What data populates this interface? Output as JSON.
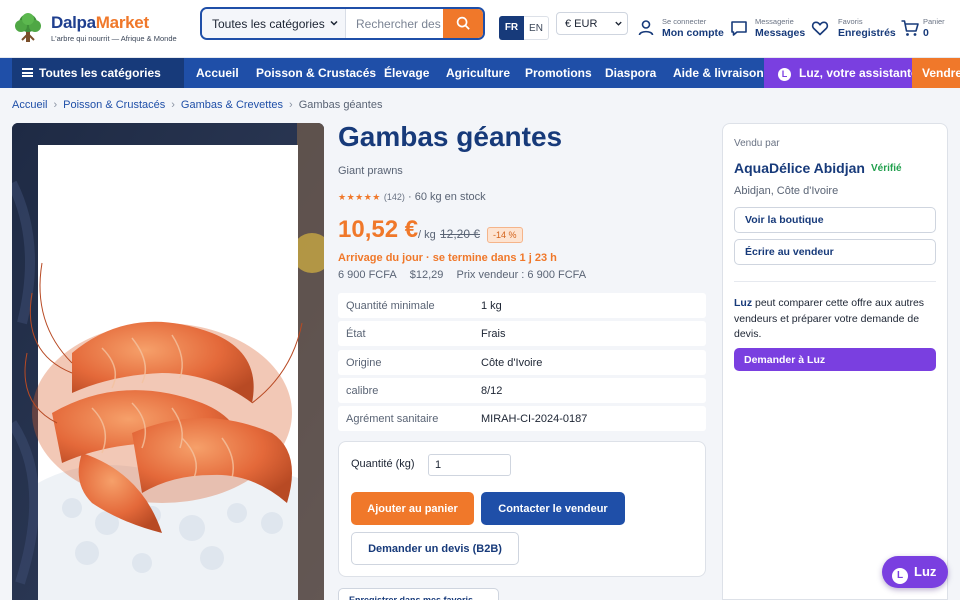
{
  "header": {
    "logo_part1": "Dalpa",
    "logo_part2": "Market",
    "tagline": "L'arbre qui nourrit — Afrique & Monde",
    "search": {
      "category": "Toutes les catégories",
      "placeholder": "Rechercher des produits"
    },
    "languages": {
      "active": "FR",
      "other": "EN"
    },
    "currency": "€ EUR",
    "account": {
      "small": "Se connecter",
      "big": "Mon compte"
    },
    "messages": {
      "small": "Messagerie",
      "big": "Messages"
    },
    "favorites": {
      "small": "Favoris",
      "big": "Enregistrés"
    },
    "cart": {
      "small": "Panier",
      "big": "0"
    }
  },
  "nav": {
    "all_categories": "Toutes les catégories",
    "links": [
      "Accueil",
      "Poisson & Crustacés",
      "Élevage",
      "Agriculture",
      "Promotions",
      "Diaspora",
      "Aide & livraison"
    ],
    "luz_badge": "L",
    "luz_label": "Luz, votre assistante",
    "sell_label": "Vendre"
  },
  "breadcrumb": [
    "Accueil",
    "Poisson & Crustacés",
    "Gambas & Crevettes",
    "Gambas géantes"
  ],
  "product": {
    "title": "Gambas géantes",
    "subtitle": "Giant prawns",
    "stars": "★★★★★",
    "reviews": "(142)",
    "stock": "· 60 kg en stock",
    "price": "10,52 €",
    "unit": "/ kg",
    "old_price": "12,20 €",
    "discount": "-14 %",
    "arrival": "Arrivage du jour · se termine dans 1 j 23 h",
    "price_fcfa": "6 900 FCFA",
    "price_usd": "$12,29",
    "seller_price": "Prix vendeur : 6 900 FCFA",
    "specs": [
      {
        "key": "Quantité minimale",
        "value": "1 kg"
      },
      {
        "key": "État",
        "value": "Frais"
      },
      {
        "key": "Origine",
        "value": "Côte d'Ivoire"
      },
      {
        "key": "calibre",
        "value": "8/12"
      },
      {
        "key": "Agrément sanitaire",
        "value": "MIRAH-CI-2024-0187"
      }
    ],
    "quantity_label": "Quantité (kg)",
    "quantity_value": "1",
    "add_to_cart": "Ajouter au panier",
    "contact_seller": "Contacter le vendeur",
    "request_quote": "Demander un devis (B2B)",
    "save_favorites": "Enregistrer dans mes favoris"
  },
  "seller": {
    "sold_by": "Vendu par",
    "name": "AquaDélice Abidjan",
    "verified": "Vérifié",
    "location": "Abidjan, Côte d'Ivoire",
    "view_shop": "Voir la boutique",
    "write_seller": "Écrire au vendeur",
    "luz_name": "Luz",
    "luz_text": " peut comparer cette offre aux autres vendeurs et préparer votre demande de devis.",
    "ask_luz": "Demander à Luz"
  },
  "float_luz": {
    "badge": "L",
    "label": "Luz"
  },
  "colors": {
    "primary": "#1f4fa8",
    "navy": "#173a7a",
    "accent": "#f0782a",
    "luz": "#7a3fe0",
    "verified": "#21a04d"
  }
}
